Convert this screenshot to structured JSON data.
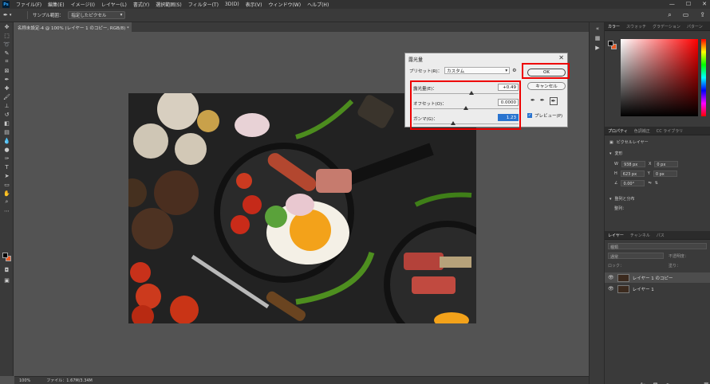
{
  "app": {
    "logo": "Ps"
  },
  "menu": [
    "ファイル(F)",
    "編集(E)",
    "イメージ(I)",
    "レイヤー(L)",
    "書式(Y)",
    "選択範囲(S)",
    "フィルター(T)",
    "3D(D)",
    "表示(V)",
    "ウィンドウ(W)",
    "ヘルプ(H)"
  ],
  "window_controls": [
    "—",
    "☐",
    "✕"
  ],
  "options": {
    "tool_icon": "eyedropper-icon",
    "sample_label": "サンプル範囲：",
    "sample_value": "指定したピクセル"
  },
  "document": {
    "tab_title": "名称未設定-4 @ 100% (レイヤー 1 のコピー, RGB/8) *",
    "tab_close": "×"
  },
  "status": {
    "zoom": "100%",
    "file_info": "ファイル：1.67M/3.34M"
  },
  "dialog": {
    "title": "露光量",
    "close": "✕",
    "preset_label": "プリセット(R)：",
    "preset_value": "カスタム",
    "sliders": [
      {
        "label": "露光量(E)：",
        "value": "+0.49",
        "level": 0.55
      },
      {
        "label": "オフセット(O)：",
        "value": "0.0000",
        "level": 0.5
      },
      {
        "label": "ガンマ(G)：",
        "value": "1.23",
        "level": 0.38
      }
    ],
    "ok": "OK",
    "cancel": "キャンセル",
    "preview_label": "プレビュー(P)"
  },
  "panels": {
    "color_tabs": [
      "カラー",
      "スウォッチ",
      "グラデーション",
      "パターン"
    ],
    "props_tabs": [
      "プロパティ",
      "色調補正",
      "CC ライブラリ"
    ],
    "props_layer": "ピクセルレイヤー",
    "transform_title": "変形",
    "w_label": "W",
    "w_value": "938 px",
    "h_label": "H",
    "h_value": "623 px",
    "x_label": "X",
    "x_value": "0 px",
    "y_label": "Y",
    "y_value": "0 px",
    "angle_value": "0.00°",
    "align_title": "整列と分布",
    "align_sub": "整列：",
    "layers_tabs": [
      "レイヤー",
      "チャンネル",
      "パス"
    ],
    "layers_kind": "種類",
    "blend_mode": "通常",
    "opacity_label": "不透明度：",
    "lock_label": "ロック：",
    "fill_label": "塗り：",
    "layers": [
      {
        "name": "レイヤー 1 のコピー",
        "active": true
      },
      {
        "name": "レイヤー 1",
        "active": false
      }
    ]
  },
  "colors": {
    "accent_red": "#e00000",
    "bg_swatch": "#e95a24",
    "select_blue": "#2a74cf"
  }
}
